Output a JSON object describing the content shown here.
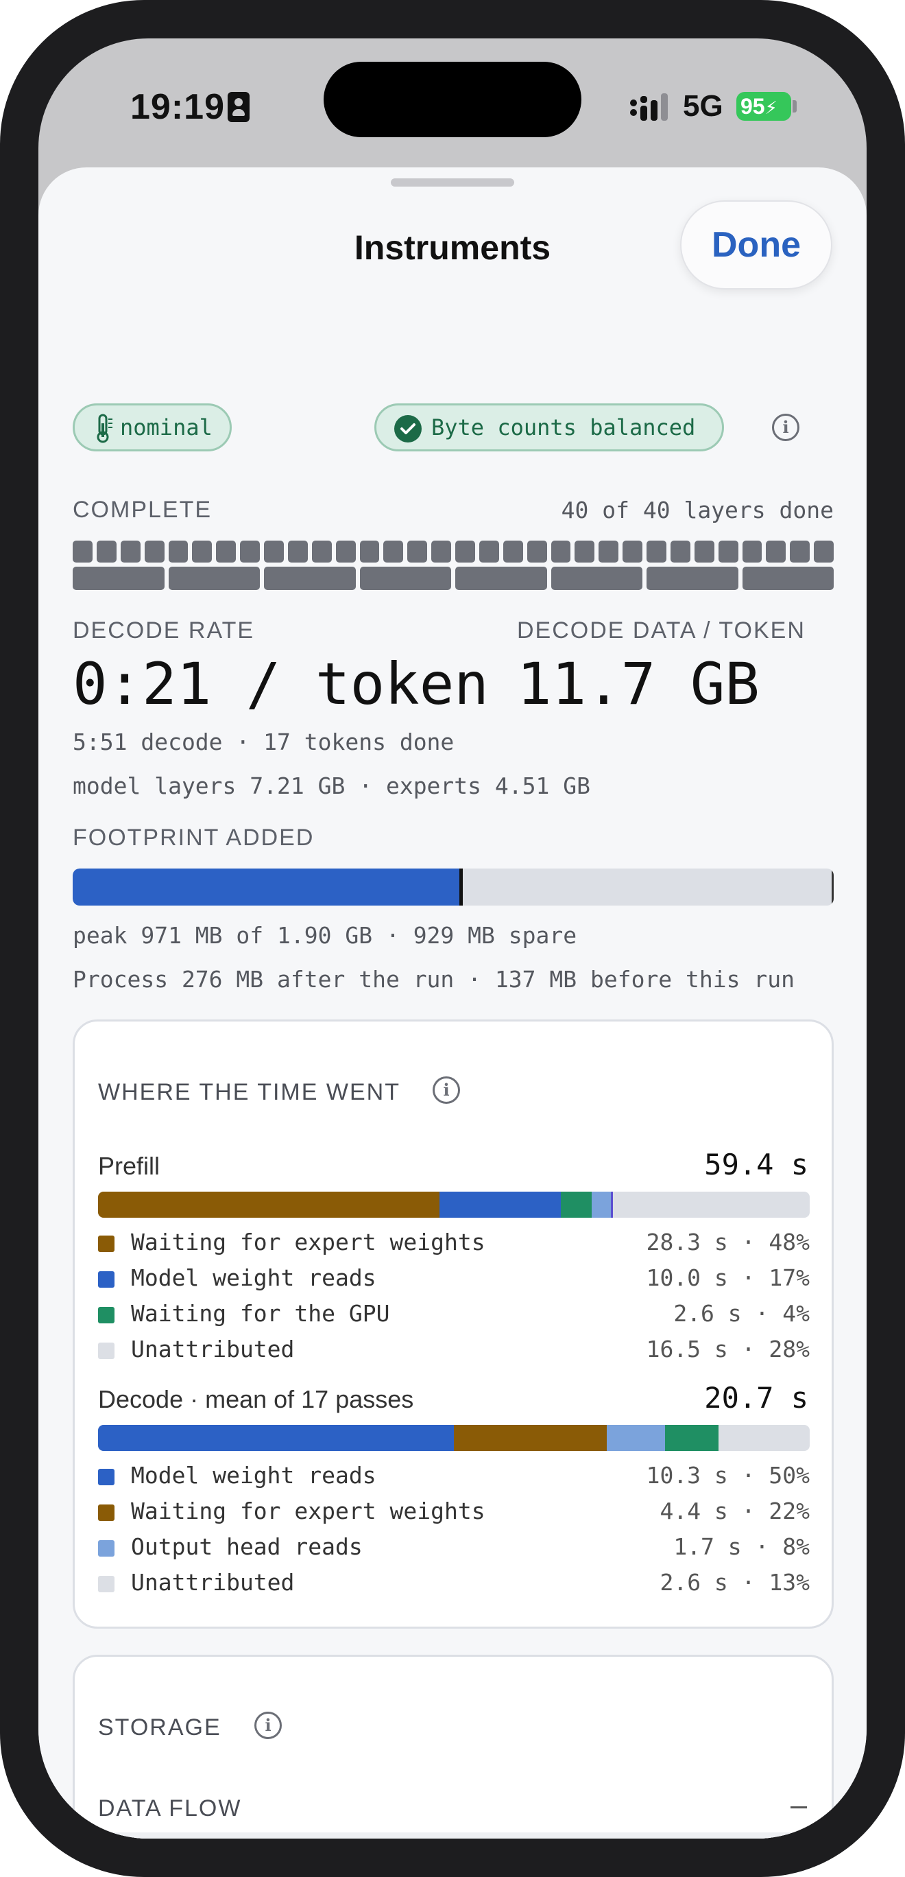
{
  "status_bar": {
    "time": "19:19",
    "network": "5G",
    "battery": "95"
  },
  "sheet": {
    "title": "Instruments",
    "done_label": "Done"
  },
  "badges": {
    "thermal": "nominal",
    "bytes": "Byte counts balanced"
  },
  "progress": {
    "label": "COMPLETE",
    "detail": "40 of 40 layers done",
    "layers_total": 40,
    "layers_done": 40
  },
  "decode": {
    "rate_label": "DECODE RATE",
    "rate_value": "0:21 / token",
    "data_label": "DECODE DATA / TOKEN",
    "data_value": "11.7 GB",
    "summary": "5:51 decode · 17 tokens done",
    "breakdown": "model layers 7.21 GB · experts 4.51 GB"
  },
  "footprint": {
    "label": "FOOTPRINT ADDED",
    "fill_fraction": 0.51,
    "peak_text": "peak 971 MB of 1.90 GB · 929 MB spare",
    "process_text": "Process 276 MB after the run · 137 MB before this run"
  },
  "time_card": {
    "title": "WHERE THE TIME WENT",
    "sections": [
      {
        "name": "Prefill",
        "total": "59.4 s",
        "segments": [
          {
            "color": "#8a5b06",
            "fraction": 0.48
          },
          {
            "color": "#2c61c5",
            "fraction": 0.17
          },
          {
            "color": "#1f8f63",
            "fraction": 0.044
          },
          {
            "color": "#7ba3dc",
            "fraction": 0.027
          },
          {
            "color": "#5b4fd1",
            "fraction": 0.003
          }
        ],
        "legend": [
          {
            "label": "Waiting for expert weights",
            "value": "28.3 s · 48%",
            "color": "#8a5b06"
          },
          {
            "label": "Model weight reads",
            "value": "10.0 s · 17%",
            "color": "#2c61c5"
          },
          {
            "label": "Waiting for the GPU",
            "value": "2.6 s · 4%",
            "color": "#1f8f63"
          },
          {
            "label": "Unattributed",
            "value": "16.5 s · 28%",
            "color": "#dcdfe5"
          }
        ]
      },
      {
        "name": "Decode · mean of 17 passes",
        "total": "20.7 s",
        "segments": [
          {
            "color": "#2c61c5",
            "fraction": 0.5
          },
          {
            "color": "#8a5b06",
            "fraction": 0.215
          },
          {
            "color": "#7ba3dc",
            "fraction": 0.082
          },
          {
            "color": "#1f8f63",
            "fraction": 0.075
          }
        ],
        "legend": [
          {
            "label": "Model weight reads",
            "value": "10.3 s · 50%",
            "color": "#2c61c5"
          },
          {
            "label": "Waiting for expert weights",
            "value": "4.4 s · 22%",
            "color": "#8a5b06"
          },
          {
            "label": "Output head reads",
            "value": "1.7 s · 8%",
            "color": "#7ba3dc"
          },
          {
            "label": "Unattributed",
            "value": "2.6 s · 13%",
            "color": "#dcdfe5"
          }
        ]
      }
    ]
  },
  "storage_card": {
    "title": "STORAGE",
    "flow_label": "DATA FLOW"
  },
  "icons": {
    "thermal": "thermometer-icon",
    "bytes": "checkmark-circle-icon",
    "info": "info-icon",
    "collapse": "minus-icon"
  }
}
